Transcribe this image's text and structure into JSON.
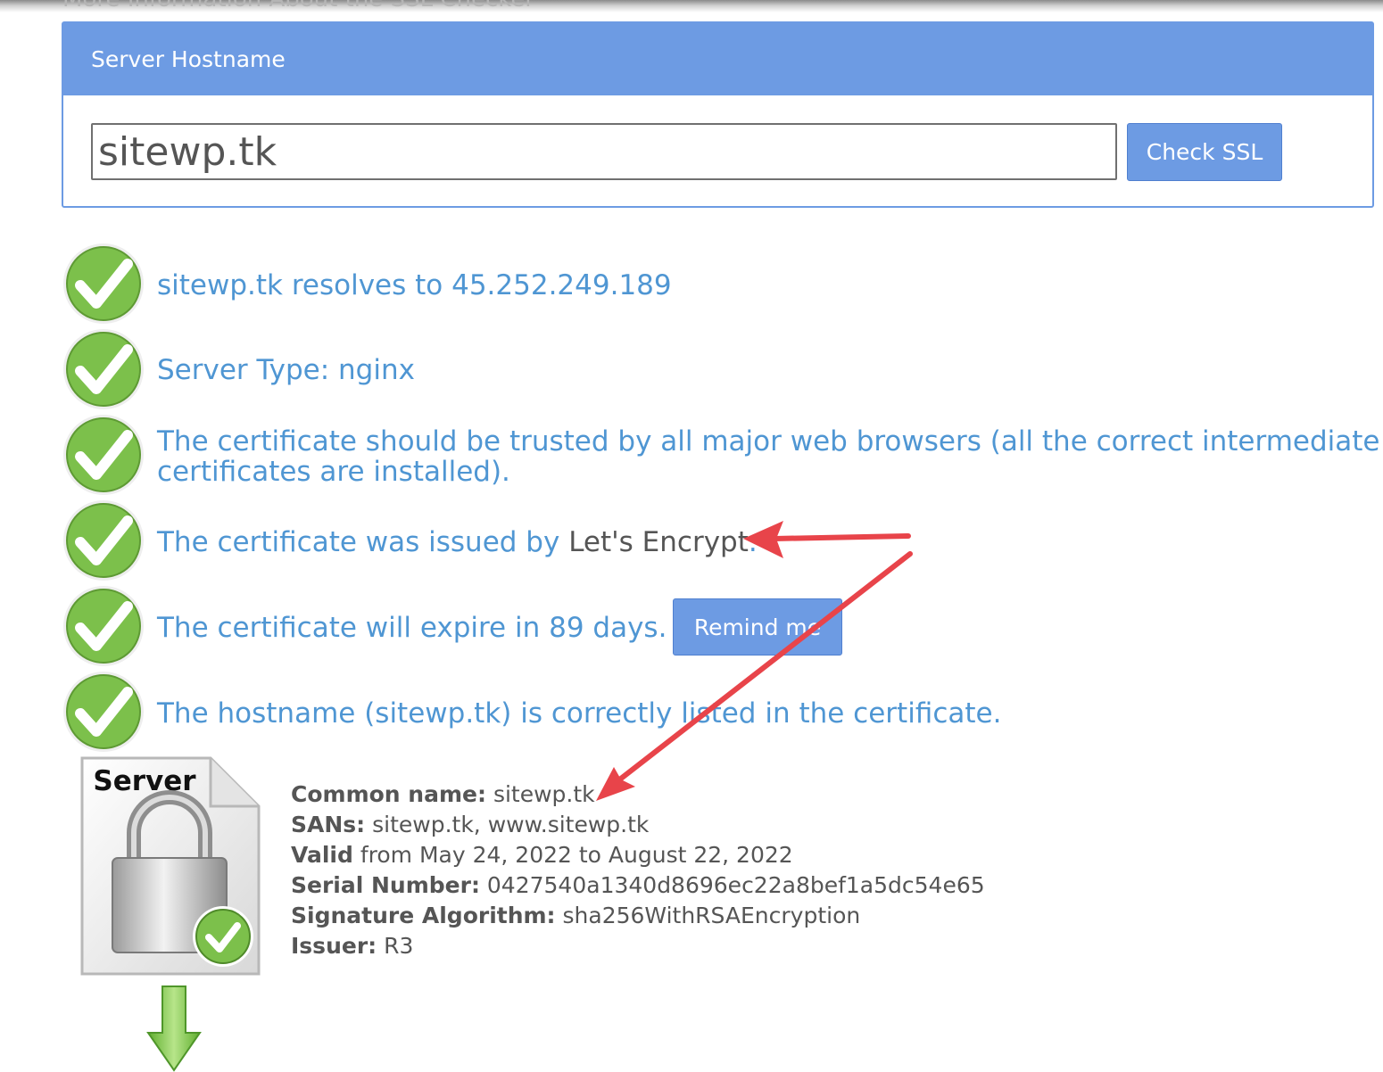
{
  "top_cut_text": "More Information About the SSL Checker",
  "form": {
    "header": "Server Hostname",
    "hostname_value": "sitewp.tk",
    "check_button": "Check SSL"
  },
  "results": [
    {
      "text": "sitewp.tk resolves to 45.252.249.189"
    },
    {
      "text": "Server Type: nginx"
    },
    {
      "line1": "The certificate should be trusted by all major web browsers (all the correct intermediate",
      "line2": "certificates are installed)."
    },
    {
      "prefix": "The certificate was issued by ",
      "issuer": "Let's Encrypt",
      "suffix": "."
    },
    {
      "text": "The certificate will expire in 89 days.",
      "button": "Remind me"
    },
    {
      "text": "The hostname (sitewp.tk) is correctly listed in the certificate."
    }
  ],
  "server_icon_label": "Server",
  "certificate": {
    "common_name_label": "Common name:",
    "common_name": "sitewp.tk",
    "sans_label": "SANs:",
    "sans": "sitewp.tk, www.sitewp.tk",
    "valid_label": "Valid",
    "valid_text": "from May 24, 2022 to August 22, 2022",
    "serial_label": "Serial Number:",
    "serial": "0427540a1340d8696ec22a8bef1a5dc54e65",
    "sigalg_label": "Signature Algorithm:",
    "sigalg": "sha256WithRSAEncryption",
    "issuer_label": "Issuer:",
    "issuer": "R3"
  },
  "colors": {
    "primary_blue": "#6d9be3",
    "result_text": "#4f96d3",
    "check_green": "#7cc04b",
    "annotation_red": "#e8444a"
  },
  "icons": [
    "check-circle-icon",
    "server-lock-icon",
    "down-arrow-icon"
  ]
}
